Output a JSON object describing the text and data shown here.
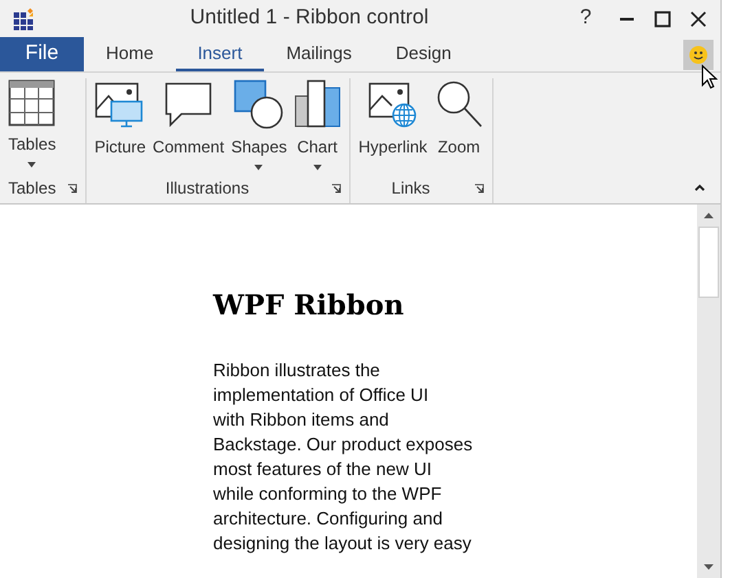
{
  "window": {
    "title": "Untitled 1 - Ribbon control",
    "help": "?"
  },
  "tabs": [
    {
      "label": "File",
      "kind": "file",
      "selected": false
    },
    {
      "label": "Home",
      "kind": "tab",
      "selected": false
    },
    {
      "label": "Insert",
      "kind": "tab",
      "selected": true
    },
    {
      "label": "Mailings",
      "kind": "tab",
      "selected": false
    },
    {
      "label": "Design",
      "kind": "tab",
      "selected": false
    }
  ],
  "groups": [
    {
      "label": "Tables",
      "items": [
        {
          "label": "Tables",
          "kind": "table",
          "dropdown": true
        }
      ]
    },
    {
      "label": "Illustrations",
      "items": [
        {
          "label": "Picture",
          "kind": "picture",
          "dropdown": false
        },
        {
          "label": "Comment",
          "kind": "comment",
          "dropdown": false
        },
        {
          "label": "Shapes",
          "kind": "shapes",
          "dropdown": true
        },
        {
          "label": "Chart",
          "kind": "chart",
          "dropdown": true
        }
      ]
    },
    {
      "label": "Links",
      "items": [
        {
          "label": "Hyperlink",
          "kind": "hyperlink",
          "dropdown": false
        },
        {
          "label": "Zoom",
          "kind": "zoom",
          "dropdown": false
        }
      ]
    }
  ],
  "document": {
    "heading": "WPF Ribbon",
    "paragraph_lines": [
      "Ribbon illustrates the",
      "implementation of Office UI",
      "with Ribbon items and",
      "Backstage. Our product exposes",
      "most features of the new UI",
      "while conforming to the WPF",
      "architecture. Configuring and",
      "designing the layout is very easy"
    ]
  }
}
